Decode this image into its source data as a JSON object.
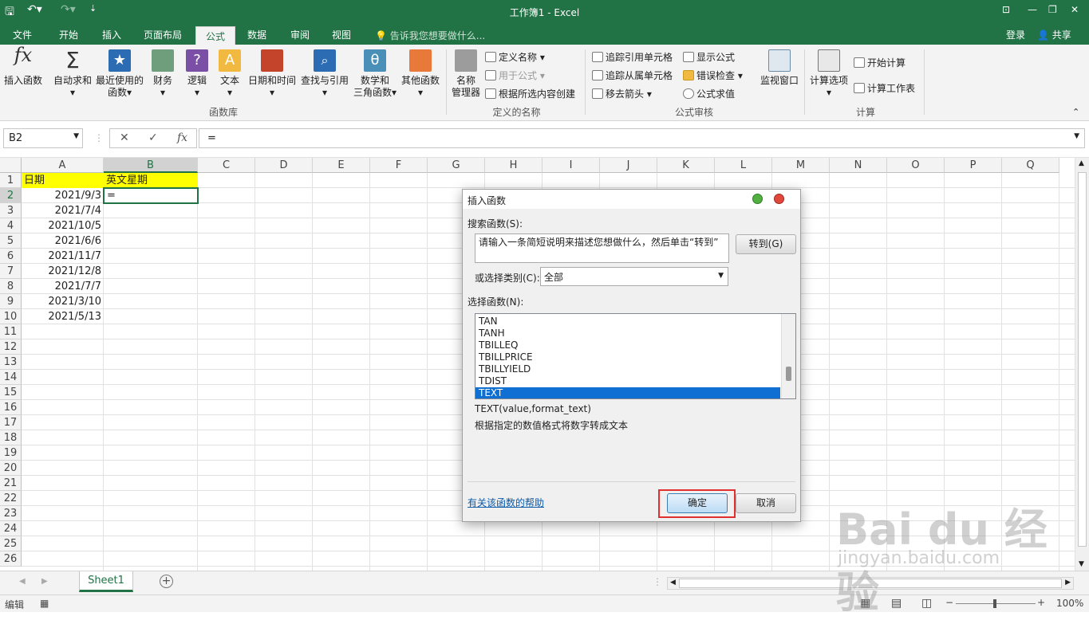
{
  "window": {
    "title": "工作簿1 - Excel"
  },
  "tabs": {
    "file": "文件",
    "home": "开始",
    "insert": "插入",
    "layout": "页面布局",
    "formulas": "公式",
    "data": "数据",
    "review": "审阅",
    "view": "视图",
    "tell": "告诉我您想要做什么...",
    "login": "登录",
    "share": "共享"
  },
  "ribbon": {
    "insert_fn": "插入函数",
    "autosum": "自动求和",
    "recent1": "最近使用的",
    "recent2": "函数",
    "finance": "财务",
    "logic": "逻辑",
    "text": "文本",
    "datetime": "日期和时间",
    "lookup": "查找与引用",
    "math1": "数学和",
    "math2": "三角函数",
    "other": "其他函数",
    "group_lib": "函数库",
    "name_mgr1": "名称",
    "name_mgr2": "管理器",
    "define_name": "定义名称",
    "use_in_formula": "用于公式",
    "create_from_sel": "根据所选内容创建",
    "group_names": "定义的名称",
    "trace_prec": "追踪引用单元格",
    "trace_dep": "追踪从属单元格",
    "remove_arrows": "移去箭头",
    "show_formulas": "显示公式",
    "error_check": "错误检查",
    "eval_formula": "公式求值",
    "watch": "监视窗口",
    "group_audit": "公式审核",
    "calc_options": "计算选项",
    "calc_now": "开始计算",
    "calc_sheet": "计算工作表",
    "group_calc": "计算"
  },
  "formula_bar": {
    "namebox": "B2",
    "cancel": "✕",
    "enter": "✓",
    "fx": "fx",
    "content": "="
  },
  "columns": [
    "A",
    "B",
    "C",
    "D",
    "E",
    "F",
    "G",
    "H",
    "I",
    "J",
    "K",
    "L",
    "M",
    "N",
    "O",
    "P",
    "Q"
  ],
  "rows": [
    "1",
    "2",
    "3",
    "4",
    "5",
    "6",
    "7",
    "8",
    "9",
    "10",
    "11",
    "12",
    "13",
    "14",
    "15",
    "16",
    "17",
    "18",
    "19",
    "20",
    "21",
    "22",
    "23",
    "24",
    "25",
    "26"
  ],
  "cells": {
    "A1": "日期",
    "B1": "英文星期",
    "B2": "=",
    "A2": "2021/9/3",
    "A3": "2021/7/4",
    "A4": "2021/10/5",
    "A5": "2021/6/6",
    "A6": "2021/11/7",
    "A7": "2021/12/8",
    "A8": "2021/7/7",
    "A9": "2021/3/10",
    "A10": "2021/5/13"
  },
  "dialog": {
    "title": "插入函数",
    "search_label": "搜索函数(S):",
    "search_value": "请输入一条简短说明来描述您想做什么，然后单击“转到”",
    "go": "转到(G)",
    "category_label": "或选择类别(C):",
    "category_value": "全部",
    "select_label": "选择函数(N):",
    "functions": [
      "TAN",
      "TANH",
      "TBILLEQ",
      "TBILLPRICE",
      "TBILLYIELD",
      "TDIST",
      "TEXT"
    ],
    "signature": "TEXT(value,format_text)",
    "description": "根据指定的数值格式将数字转成文本",
    "help_link": "有关该函数的帮助",
    "ok": "确定",
    "cancel": "取消"
  },
  "sheet": {
    "tab": "Sheet1",
    "add": "+"
  },
  "status": {
    "mode": "编辑",
    "zoom": "100%"
  },
  "watermark": {
    "brand": "Bai du 经验",
    "url": "jingyan.baidu.com"
  },
  "colors": {
    "excel_green": "#217346",
    "header_yellow": "#ffff00",
    "selection_blue": "#0f6fd2",
    "highlight_red": "#e03030"
  }
}
